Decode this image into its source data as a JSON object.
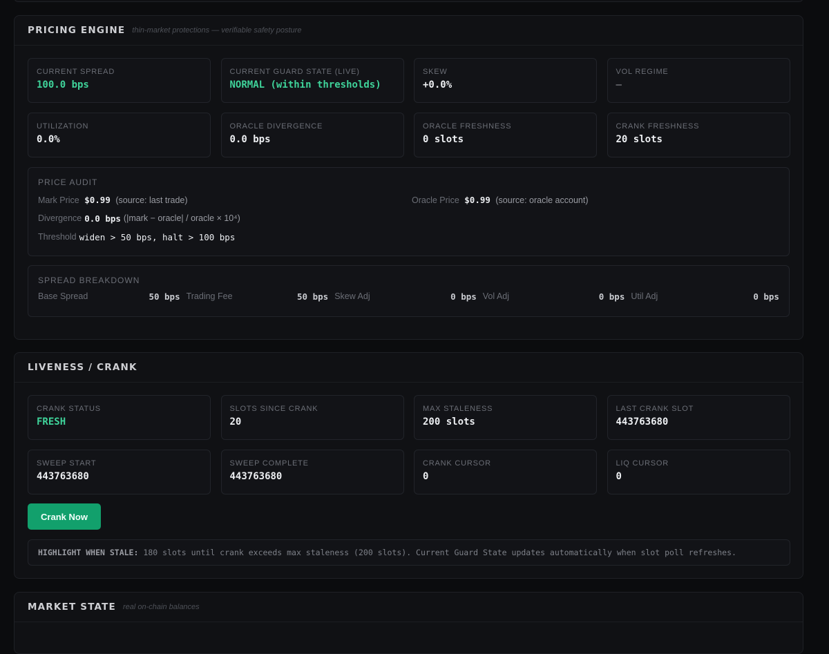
{
  "pricing_engine": {
    "title": "PRICING ENGINE",
    "subtitle": "thin-market protections — verifiable safety posture",
    "metrics": [
      {
        "label": "CURRENT SPREAD",
        "value": "100.0 bps"
      },
      {
        "label": "CURRENT GUARD STATE (LIVE)",
        "value": "NORMAL (within thresholds)"
      },
      {
        "label": "SKEW",
        "value": "+0.0%"
      },
      {
        "label": "VOL REGIME",
        "value": "—"
      },
      {
        "label": "UTILIZATION",
        "value": "0.0%"
      },
      {
        "label": "ORACLE DIVERGENCE",
        "value": "0.0 bps"
      },
      {
        "label": "ORACLE FRESHNESS",
        "value": "0 slots"
      },
      {
        "label": "CRANK FRESHNESS",
        "value": "20 slots"
      }
    ],
    "price_audit": {
      "title": "PRICE AUDIT",
      "mark_label": "Mark Price",
      "mark_value": "$0.99",
      "mark_source": "(source: last trade)",
      "oracle_label": "Oracle Price",
      "oracle_value": "$0.99",
      "oracle_source": "(source: oracle account)",
      "divergence_label": "Divergence",
      "divergence_value": "0.0 bps",
      "divergence_formula": "(|mark − oracle| / oracle × 10⁴)",
      "threshold_label": "Threshold",
      "threshold_value": "widen > 50 bps, halt > 100 bps"
    },
    "spread_breakdown": {
      "title": "SPREAD BREAKDOWN",
      "items": [
        {
          "label": "Base Spread",
          "value": "50 bps"
        },
        {
          "label": "Trading Fee",
          "value": "50 bps"
        },
        {
          "label": "Skew Adj",
          "value": "0 bps"
        },
        {
          "label": "Vol Adj",
          "value": "0 bps"
        },
        {
          "label": "Util Adj",
          "value": "0 bps"
        }
      ]
    }
  },
  "liveness": {
    "title": "LIVENESS / CRANK",
    "metrics": [
      {
        "label": "CRANK STATUS",
        "value": "FRESH"
      },
      {
        "label": "SLOTS SINCE CRANK",
        "value": "20"
      },
      {
        "label": "MAX STALENESS",
        "value": "200 slots"
      },
      {
        "label": "LAST CRANK SLOT",
        "value": "443763680"
      },
      {
        "label": "SWEEP START",
        "value": "443763680"
      },
      {
        "label": "SWEEP COMPLETE",
        "value": "443763680"
      },
      {
        "label": "CRANK CURSOR",
        "value": "0"
      },
      {
        "label": "LIQ CURSOR",
        "value": "0"
      }
    ],
    "crank_button_label": "Crank Now",
    "notice_label": "HIGHLIGHT WHEN STALE:",
    "notice_text": "180 slots until crank exceeds max staleness (200 slots). Current Guard State updates automatically when slot poll refreshes."
  },
  "market_state": {
    "title": "MARKET STATE",
    "subtitle": "real on-chain balances"
  },
  "colors": {
    "accent_green": "#3fd39a",
    "button_green": "#12a06c",
    "background": "#0b0c0e",
    "panel": "#101114"
  }
}
